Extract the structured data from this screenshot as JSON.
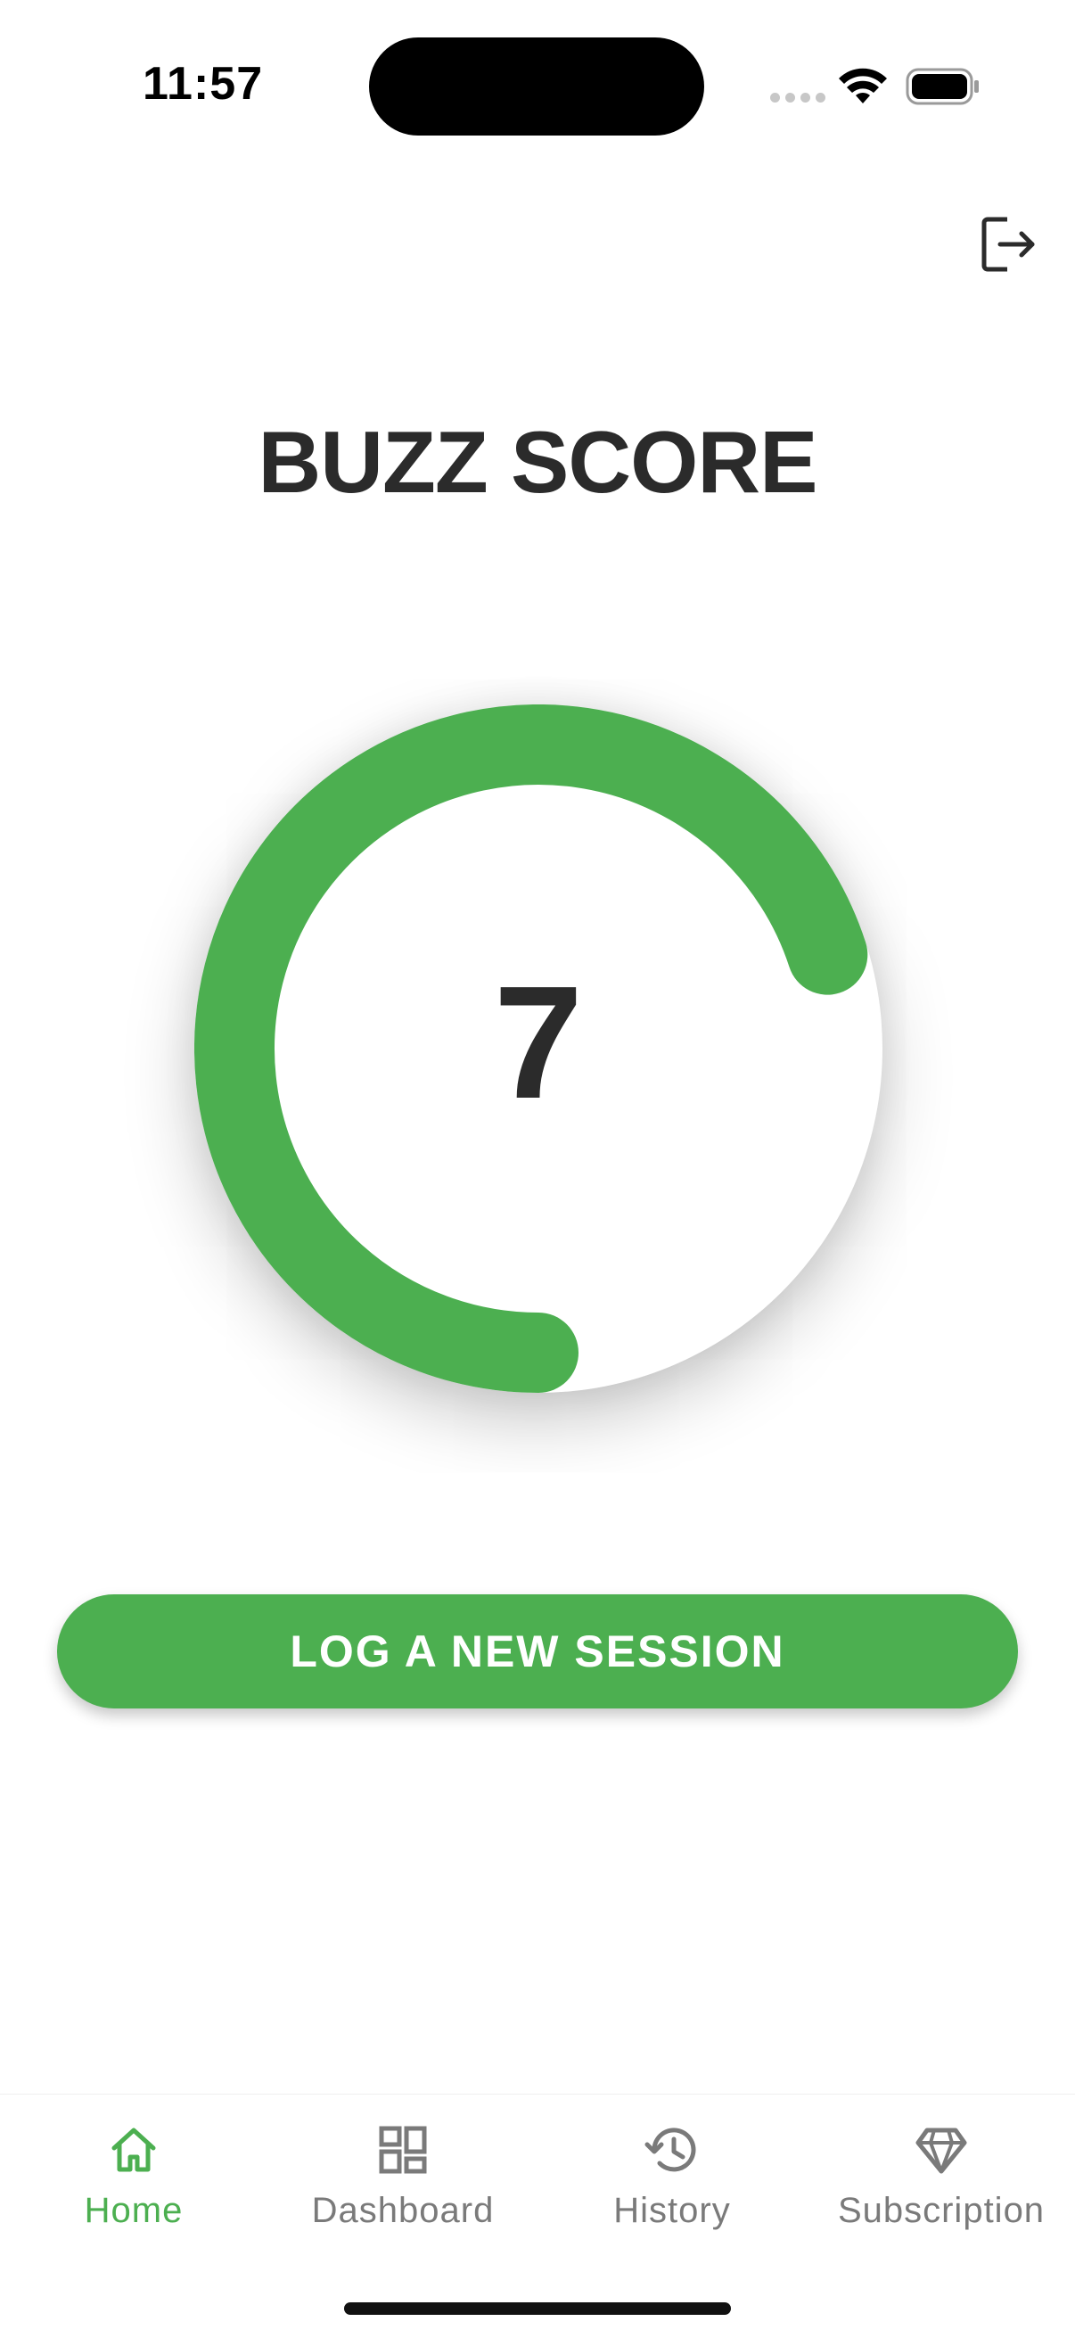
{
  "status_bar": {
    "time": "11:57"
  },
  "header": {
    "title": "BUZZ SCORE"
  },
  "gauge": {
    "value": "7",
    "progress": 0.7,
    "color": "#4caf50"
  },
  "cta": {
    "label": "LOG A NEW SESSION"
  },
  "bottom_nav": {
    "items": [
      {
        "label": "Home",
        "icon": "home-icon",
        "active": true
      },
      {
        "label": "Dashboard",
        "icon": "dashboard-icon",
        "active": false
      },
      {
        "label": "History",
        "icon": "history-icon",
        "active": false
      },
      {
        "label": "Subscription",
        "icon": "diamond-icon",
        "active": false
      }
    ],
    "active_color": "#4caf50",
    "inactive_color": "#7a7a7a"
  }
}
